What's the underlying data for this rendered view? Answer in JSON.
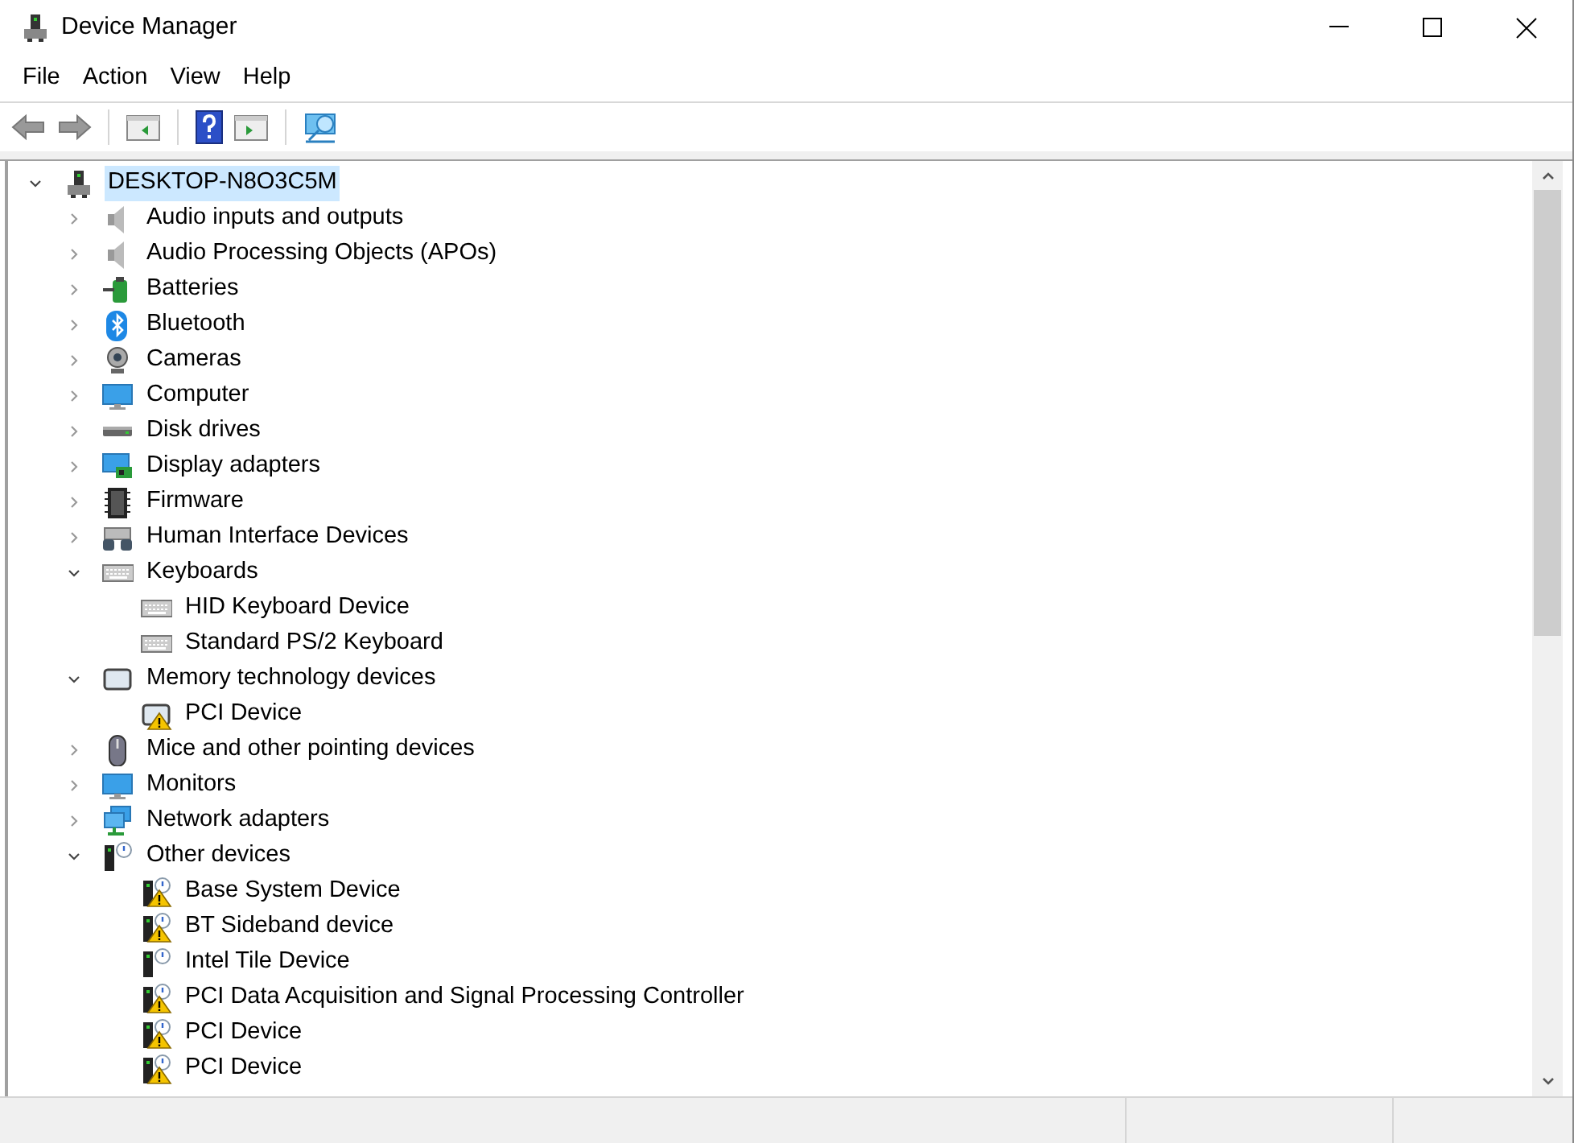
{
  "window": {
    "title": "Device Manager"
  },
  "menu": [
    "File",
    "Action",
    "View",
    "Help"
  ],
  "toolbar": [
    {
      "kind": "back",
      "disabled": true
    },
    {
      "kind": "forward",
      "disabled": true
    },
    {
      "kind": "sep"
    },
    {
      "kind": "console"
    },
    {
      "kind": "sep"
    },
    {
      "kind": "help"
    },
    {
      "kind": "pane"
    },
    {
      "kind": "sep"
    },
    {
      "kind": "monitor"
    }
  ],
  "tree": {
    "label": "DESKTOP-N8O3C5M",
    "kind": "computer-root",
    "expanded": true,
    "selected": true,
    "children": [
      {
        "label": "Audio inputs and outputs",
        "kind": "speaker",
        "expanded": false,
        "selected": false
      },
      {
        "label": "Audio Processing Objects (APOs)",
        "kind": "speaker",
        "expanded": false,
        "selected": false
      },
      {
        "label": "Batteries",
        "kind": "battery",
        "expanded": false,
        "selected": false
      },
      {
        "label": "Bluetooth",
        "kind": "bluetooth",
        "expanded": false,
        "selected": false
      },
      {
        "label": "Cameras",
        "kind": "camera",
        "expanded": false,
        "selected": false
      },
      {
        "label": "Computer",
        "kind": "monitor",
        "expanded": false,
        "selected": false
      },
      {
        "label": "Disk drives",
        "kind": "disk",
        "expanded": false,
        "selected": false
      },
      {
        "label": "Display adapters",
        "kind": "display",
        "expanded": false,
        "selected": false
      },
      {
        "label": "Firmware",
        "kind": "chip",
        "expanded": false,
        "selected": false
      },
      {
        "label": "Human Interface Devices",
        "kind": "hid",
        "expanded": false,
        "selected": false
      },
      {
        "label": "Keyboards",
        "kind": "keyboard",
        "expanded": true,
        "selected": false,
        "children": [
          {
            "label": "HID Keyboard Device",
            "kind": "keyboard",
            "selected": false
          },
          {
            "label": "Standard PS/2 Keyboard",
            "kind": "keyboard",
            "selected": false
          }
        ]
      },
      {
        "label": "Memory technology devices",
        "kind": "memory",
        "expanded": true,
        "selected": false,
        "children": [
          {
            "label": "PCI Device",
            "kind": "memory-warning",
            "selected": false
          }
        ]
      },
      {
        "label": "Mice and other pointing devices",
        "kind": "mouse",
        "expanded": false,
        "selected": false
      },
      {
        "label": "Monitors",
        "kind": "monitor",
        "expanded": false,
        "selected": false
      },
      {
        "label": "Network adapters",
        "kind": "network",
        "expanded": false,
        "selected": false
      },
      {
        "label": "Other devices",
        "kind": "unknown",
        "expanded": true,
        "selected": false,
        "children": [
          {
            "label": "Base System Device",
            "kind": "unknown-warning",
            "selected": false
          },
          {
            "label": "BT Sideband device",
            "kind": "unknown-warning",
            "selected": false
          },
          {
            "label": "Intel Tile Device",
            "kind": "unknown",
            "selected": false
          },
          {
            "label": "PCI Data Acquisition and Signal Processing Controller",
            "kind": "unknown-warning",
            "selected": false
          },
          {
            "label": "PCI Device",
            "kind": "unknown-warning",
            "selected": false
          },
          {
            "label": "PCI Device",
            "kind": "unknown-warning",
            "selected": false
          }
        ]
      }
    ]
  }
}
